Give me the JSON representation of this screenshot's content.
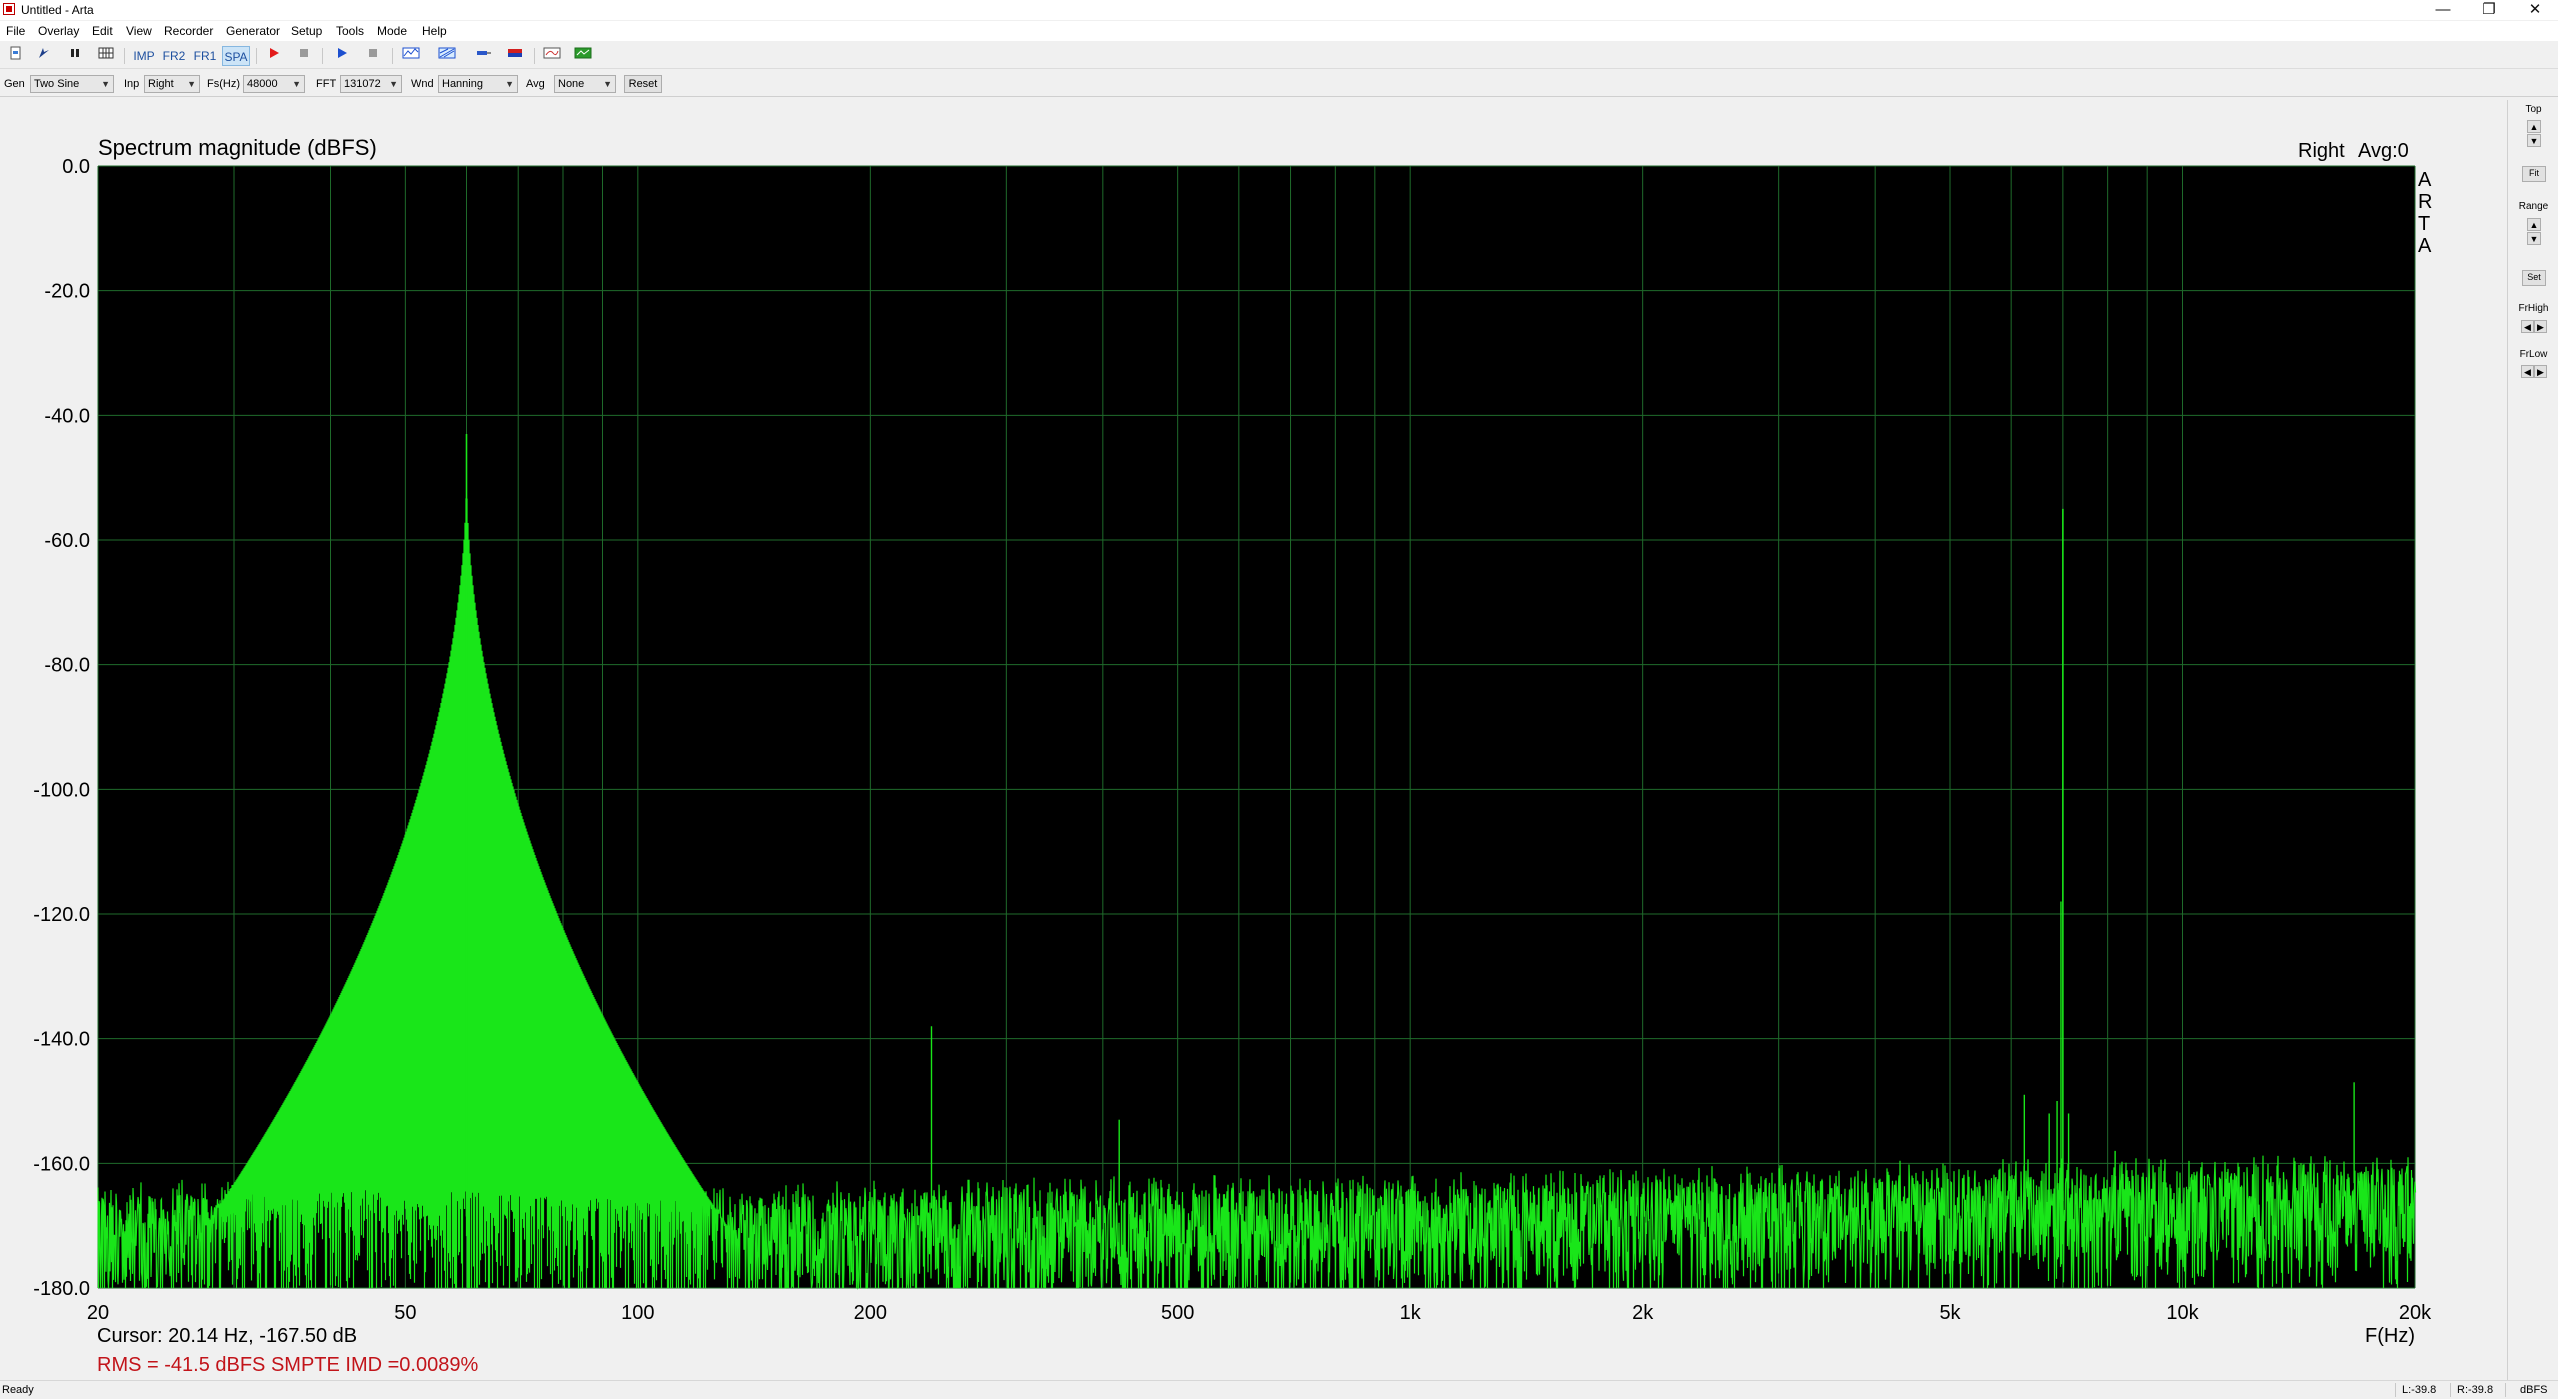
{
  "window": {
    "title": "Untitled - Arta",
    "app_icon": "arta-app-icon",
    "controls": [
      "minimize",
      "restore",
      "close"
    ]
  },
  "menu": [
    "File",
    "Overlay",
    "Edit",
    "View",
    "Recorder",
    "Generator",
    "Setup",
    "Tools",
    "Mode",
    "Help"
  ],
  "toolbar": {
    "icons": [
      "new-file-icon",
      "open-icon",
      "pause-icon",
      "grid-icon",
      "record-icon",
      "stop-icon",
      "play-icon",
      "stop-icon",
      "analyzer-icon",
      "calibrate-icon",
      "probe-icon",
      "level-icon",
      "graph-icon",
      "export-icon"
    ],
    "modes": [
      "IMP",
      "FR2",
      "FR1",
      "SPA"
    ],
    "active_mode": "SPA"
  },
  "params": {
    "gen_label": "Gen",
    "gen_value": "Two Sine",
    "inp_label": "Inp",
    "inp_value": "Right",
    "fs_label": "Fs(Hz)",
    "fs_value": "48000",
    "fft_label": "FFT",
    "fft_value": "131072",
    "wnd_label": "Wnd",
    "wnd_value": "Hanning",
    "avg_label": "Avg",
    "avg_value": "None",
    "reset_label": "Reset"
  },
  "chart_data": {
    "type": "line",
    "title": "Spectrum magnitude (dBFS)",
    "channel_label": "Right",
    "avg_label": "Avg:0",
    "side_label": [
      "A",
      "R",
      "T",
      "A"
    ],
    "xlabel": "F(Hz)",
    "xscale": "log",
    "xlim": [
      20,
      20000
    ],
    "ylim": [
      -180,
      0
    ],
    "x_ticks": [
      20,
      50,
      100,
      200,
      500,
      1000,
      2000,
      5000,
      10000,
      20000
    ],
    "x_tick_labels": [
      "20",
      "50",
      "100",
      "200",
      "500",
      "1k",
      "2k",
      "5k",
      "10k",
      "20k"
    ],
    "y_ticks": [
      0,
      -20,
      -40,
      -60,
      -80,
      -100,
      -120,
      -140,
      -160,
      -180
    ],
    "y_tick_labels": [
      "0.0",
      "-20.0",
      "-40.0",
      "-60.0",
      "-80.0",
      "-100.0",
      "-120.0",
      "-140.0",
      "-160.0",
      "-180.0"
    ],
    "grid": true,
    "background": "#000000",
    "grid_color": "#1f6b2b",
    "trace_color": "#19e619",
    "series": [
      {
        "tones": [
          {
            "freq_hz": 60,
            "level_db": -43.0
          },
          {
            "freq_hz": 7000,
            "level_db": -55.0
          }
        ],
        "spurs": [
          {
            "freq_hz": 240,
            "level_db": -138
          },
          {
            "freq_hz": 420,
            "level_db": -153
          },
          {
            "freq_hz": 6960,
            "level_db": -118
          },
          {
            "freq_hz": 6880,
            "level_db": -150
          },
          {
            "freq_hz": 7120,
            "level_db": -152
          },
          {
            "freq_hz": 6720,
            "level_db": -152
          },
          {
            "freq_hz": 6240,
            "level_db": -149
          },
          {
            "freq_hz": 8180,
            "level_db": -158
          },
          {
            "freq_hz": 16680,
            "level_db": -147
          }
        ],
        "noise_floor_db": [
          {
            "freq_hz": 20,
            "level_db": -166
          },
          {
            "freq_hz": 50,
            "level_db": -164
          },
          {
            "freq_hz": 100,
            "level_db": -166
          },
          {
            "freq_hz": 1000,
            "level_db": -164
          },
          {
            "freq_hz": 20000,
            "level_db": -161
          }
        ]
      }
    ]
  },
  "readouts": {
    "cursor": "Cursor: 20.14 Hz, -167.50 dB",
    "rms": "RMS =  -41.5 dBFS  SMPTE IMD =0.0089%"
  },
  "rightpanel": {
    "top_label": "Top",
    "fit_label": "Fit",
    "range_label": "Range",
    "set_label": "Set",
    "frhigh_label": "FrHigh",
    "frlow_label": "FrLow"
  },
  "status": {
    "ready": "Ready",
    "left_level": "L:-39.8",
    "right_level": "R:-39.8",
    "unit": "dBFS"
  }
}
